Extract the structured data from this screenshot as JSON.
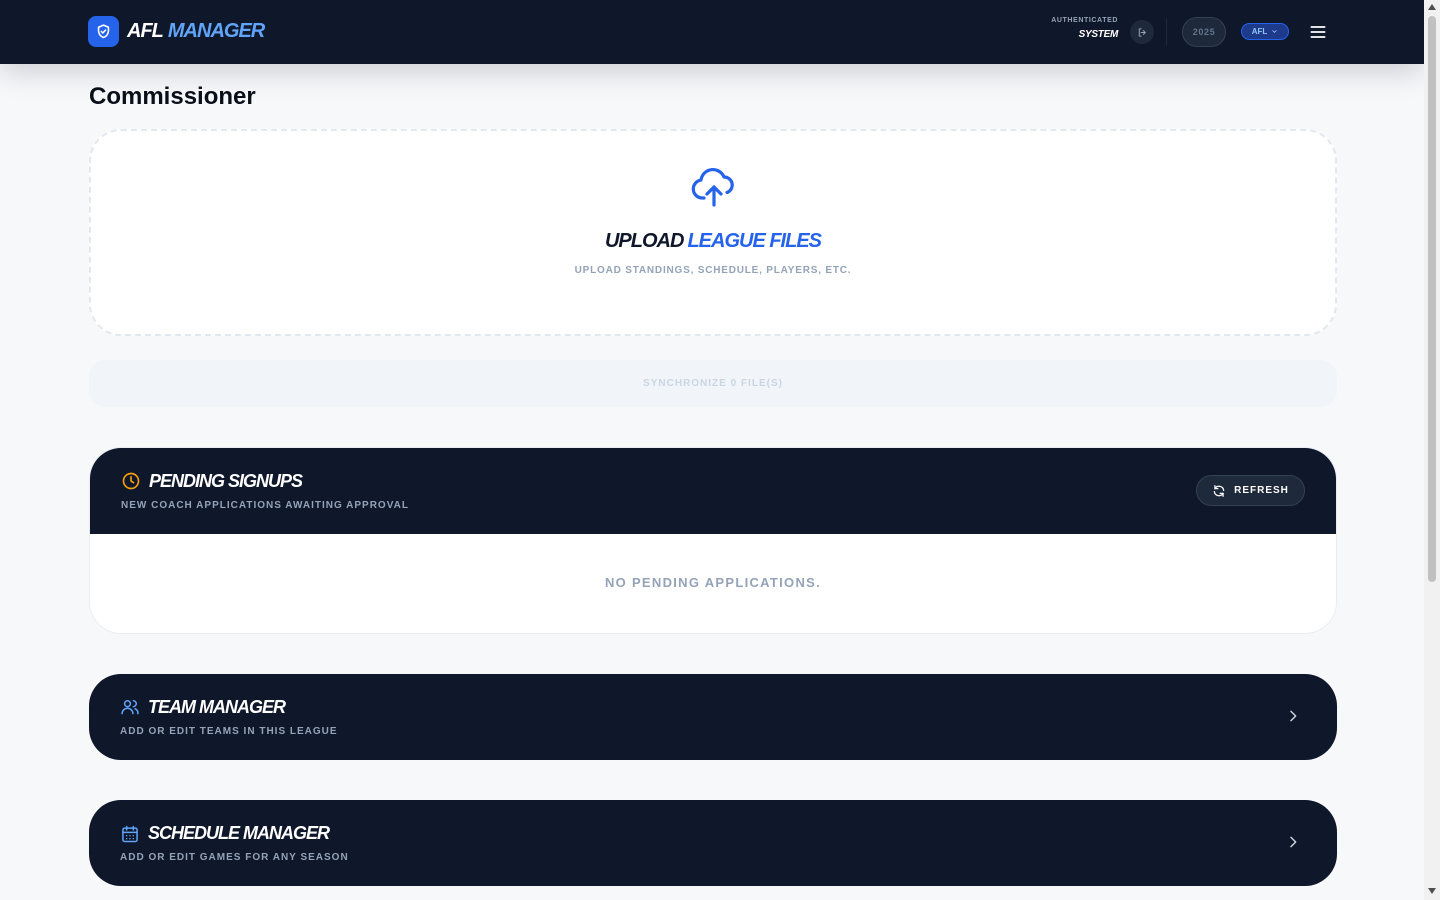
{
  "header": {
    "brand_part1": "AFL",
    "brand_part2": "MANAGER",
    "auth_label": "AUTHENTICATED",
    "auth_user": "SYSTEM",
    "season": "2025",
    "league": "AFL"
  },
  "page": {
    "title": "Commissioner"
  },
  "upload": {
    "title_part1": "UPLOAD",
    "title_part2": "LEAGUE FILES",
    "subtitle": "UPLOAD STANDINGS, SCHEDULE, PLAYERS, ETC.",
    "sync_label": "SYNCHRONIZE 0 FILE(S)"
  },
  "signups": {
    "title": "PENDING SIGNUPS",
    "subtitle": "NEW COACH APPLICATIONS AWAITING APPROVAL",
    "refresh_label": "REFRESH",
    "empty_message": "NO PENDING APPLICATIONS."
  },
  "team_manager": {
    "title": "TEAM MANAGER",
    "subtitle": "ADD OR EDIT TEAMS IN THIS LEAGUE"
  },
  "schedule_manager": {
    "title": "SCHEDULE MANAGER",
    "subtitle": "ADD OR EDIT GAMES FOR ANY SEASON"
  },
  "colors": {
    "navy": "#0f172a",
    "accent_blue": "#2563eb",
    "light_blue": "#60a5fa",
    "amber": "#f59e0b",
    "muted": "#94a3b8"
  },
  "icons": {
    "brand": "shield-check-icon",
    "logout": "logout-icon",
    "menu": "hamburger-menu-icon",
    "upload": "cloud-upload-icon",
    "signups": "clock-icon",
    "refresh": "refresh-icon",
    "team": "users-icon",
    "schedule": "calendar-icon",
    "chevron": "chevron-right-icon"
  }
}
